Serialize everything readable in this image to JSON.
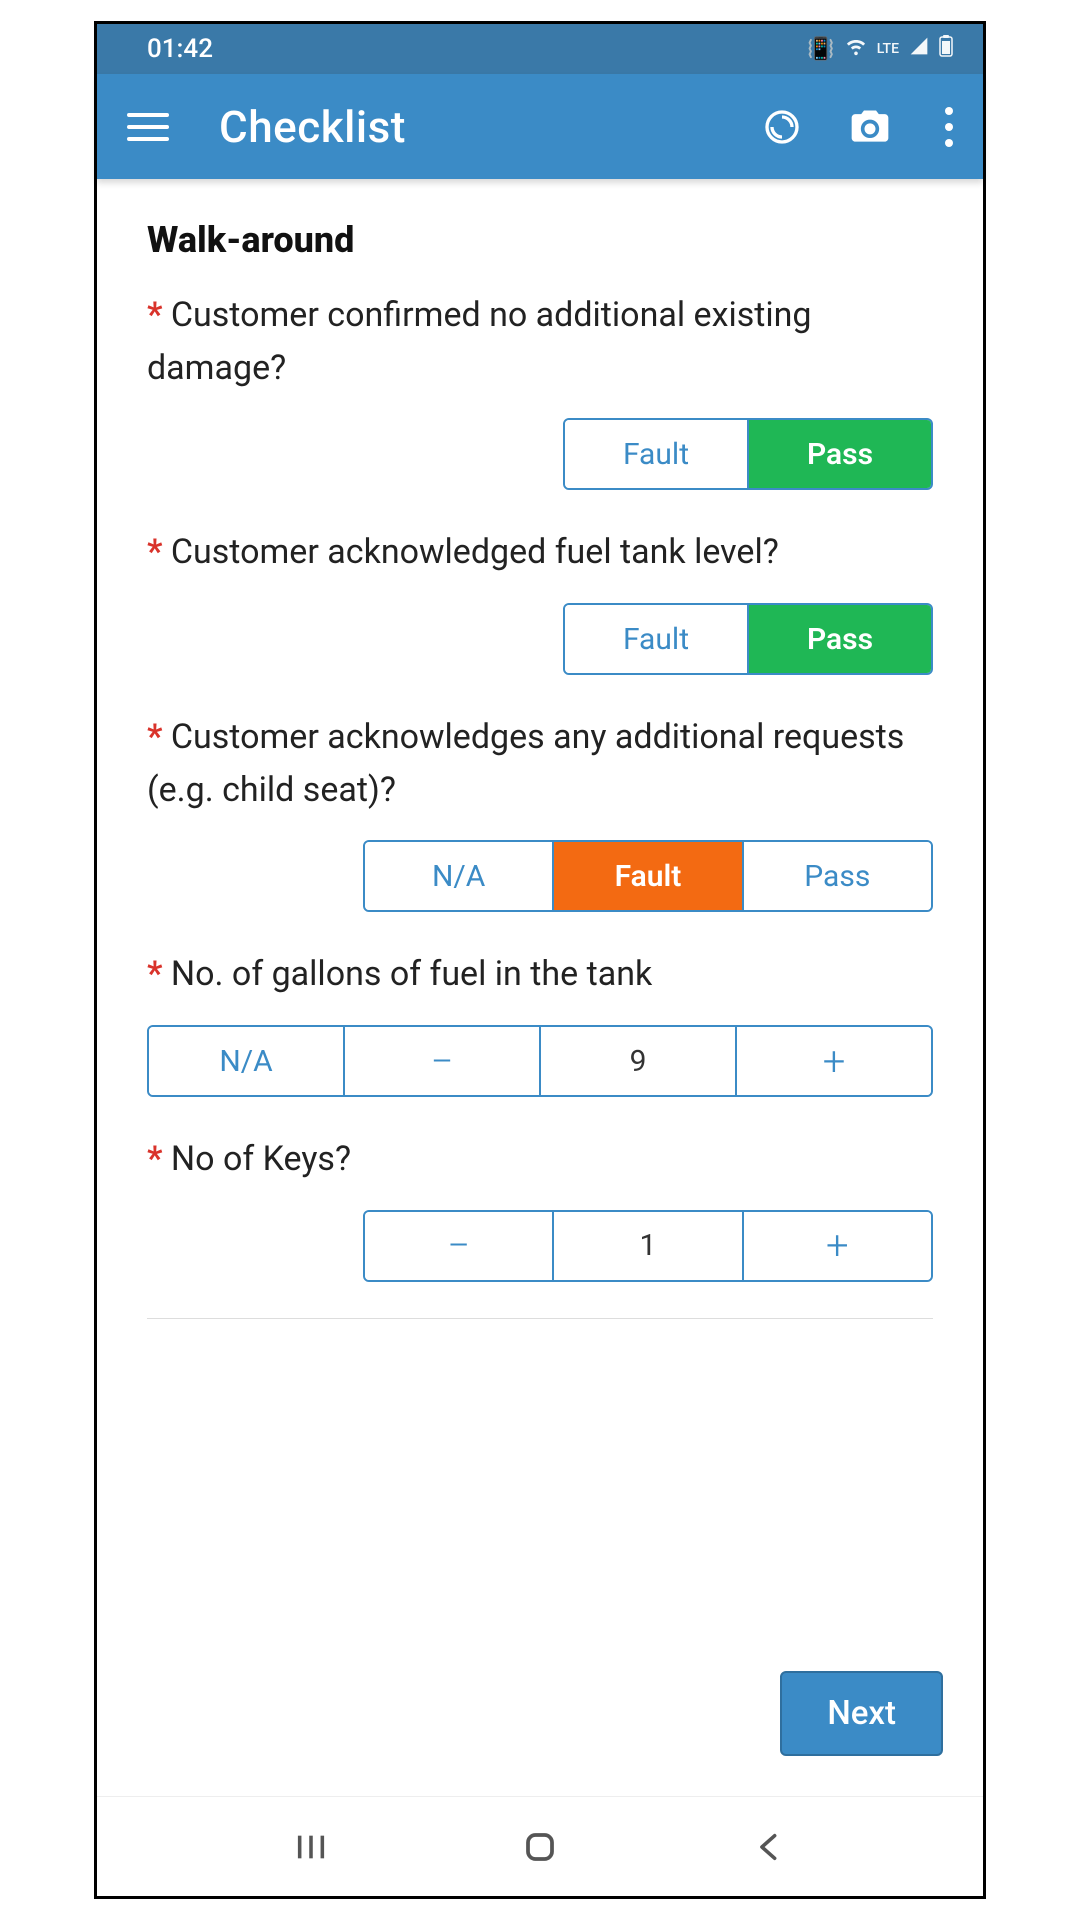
{
  "status": {
    "time": "01:42",
    "indicators": [
      "vibrate",
      "wifi",
      "lte",
      "signal",
      "battery"
    ]
  },
  "appbar": {
    "title": "Checklist"
  },
  "section": {
    "title": "Walk-around"
  },
  "questions": {
    "q1": {
      "text": "Customer confirmed no additional existing damage?",
      "required": true,
      "options": {
        "fault": "Fault",
        "pass": "Pass"
      },
      "selected": "pass"
    },
    "q2": {
      "text": "Customer acknowledged fuel tank level?",
      "required": true,
      "options": {
        "fault": "Fault",
        "pass": "Pass"
      },
      "selected": "pass"
    },
    "q3": {
      "text": "Customer acknowledges any additional requests (e.g. child seat)?",
      "required": true,
      "options": {
        "na": "N/A",
        "fault": "Fault",
        "pass": "Pass"
      },
      "selected": "fault"
    },
    "q4": {
      "text": "No. of gallons of fuel in the tank",
      "required": true,
      "na_label": "N/A",
      "minus": "−",
      "plus": "+",
      "value": "9"
    },
    "q5": {
      "text": "No of Keys?",
      "required": true,
      "minus": "−",
      "plus": "+",
      "value": "1"
    }
  },
  "footer": {
    "next": "Next"
  },
  "colors": {
    "primary": "#3b8bc6",
    "pass": "#1fb755",
    "fault": "#f36a12",
    "required": "#d9332b"
  }
}
